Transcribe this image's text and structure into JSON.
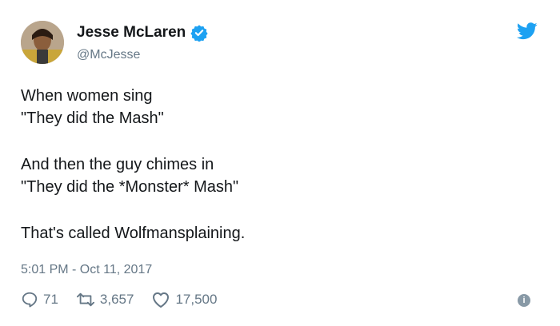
{
  "author": {
    "name": "Jesse McLaren",
    "handle": "@McJesse",
    "verified_icon": "verified-badge-icon"
  },
  "tweet": {
    "lines": [
      "When women sing",
      "\"They did the Mash\"",
      "And then the guy chimes in",
      "\"They did the *Monster* Mash\"",
      "That's called Wolfmansplaining."
    ],
    "timestamp": "5:01 PM - Oct 11, 2017"
  },
  "actions": {
    "replies": "71",
    "retweets": "3,657",
    "likes": "17,500"
  },
  "colors": {
    "twitter_blue": "#1da1f2",
    "muted_gray": "#657786",
    "text": "#14171a"
  },
  "icons": {
    "brand": "twitter-bird-icon",
    "reply": "reply-icon",
    "retweet": "retweet-icon",
    "like": "heart-icon",
    "info": "info-icon"
  }
}
